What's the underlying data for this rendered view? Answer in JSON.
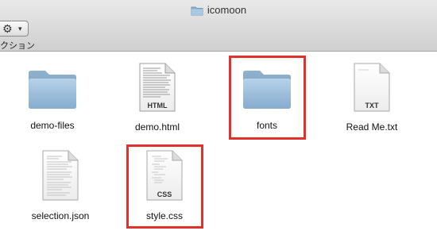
{
  "window": {
    "title": "icomoon",
    "title_icon": "folder-icon"
  },
  "toolbar": {
    "action_button_icon": "gear-icon",
    "action_menu_icon": "chevron-down-icon",
    "action_label": "クション"
  },
  "files": [
    {
      "name": "demo-files",
      "kind": "folder",
      "icon": "folder-icon"
    },
    {
      "name": "demo.html",
      "kind": "document",
      "badge": "HTML",
      "icon": "html-file-icon"
    },
    {
      "name": "fonts",
      "kind": "folder",
      "icon": "folder-icon",
      "highlighted": true
    },
    {
      "name": "Read Me.txt",
      "kind": "document",
      "badge": "TXT",
      "icon": "txt-file-icon"
    },
    {
      "name": "selection.json",
      "kind": "document",
      "icon": "json-file-icon"
    },
    {
      "name": "style.css",
      "kind": "document",
      "badge": "CSS",
      "icon": "css-file-icon",
      "highlighted": true
    }
  ],
  "colors": {
    "highlight": "#e0312b",
    "folder": "#8fb4d3"
  }
}
